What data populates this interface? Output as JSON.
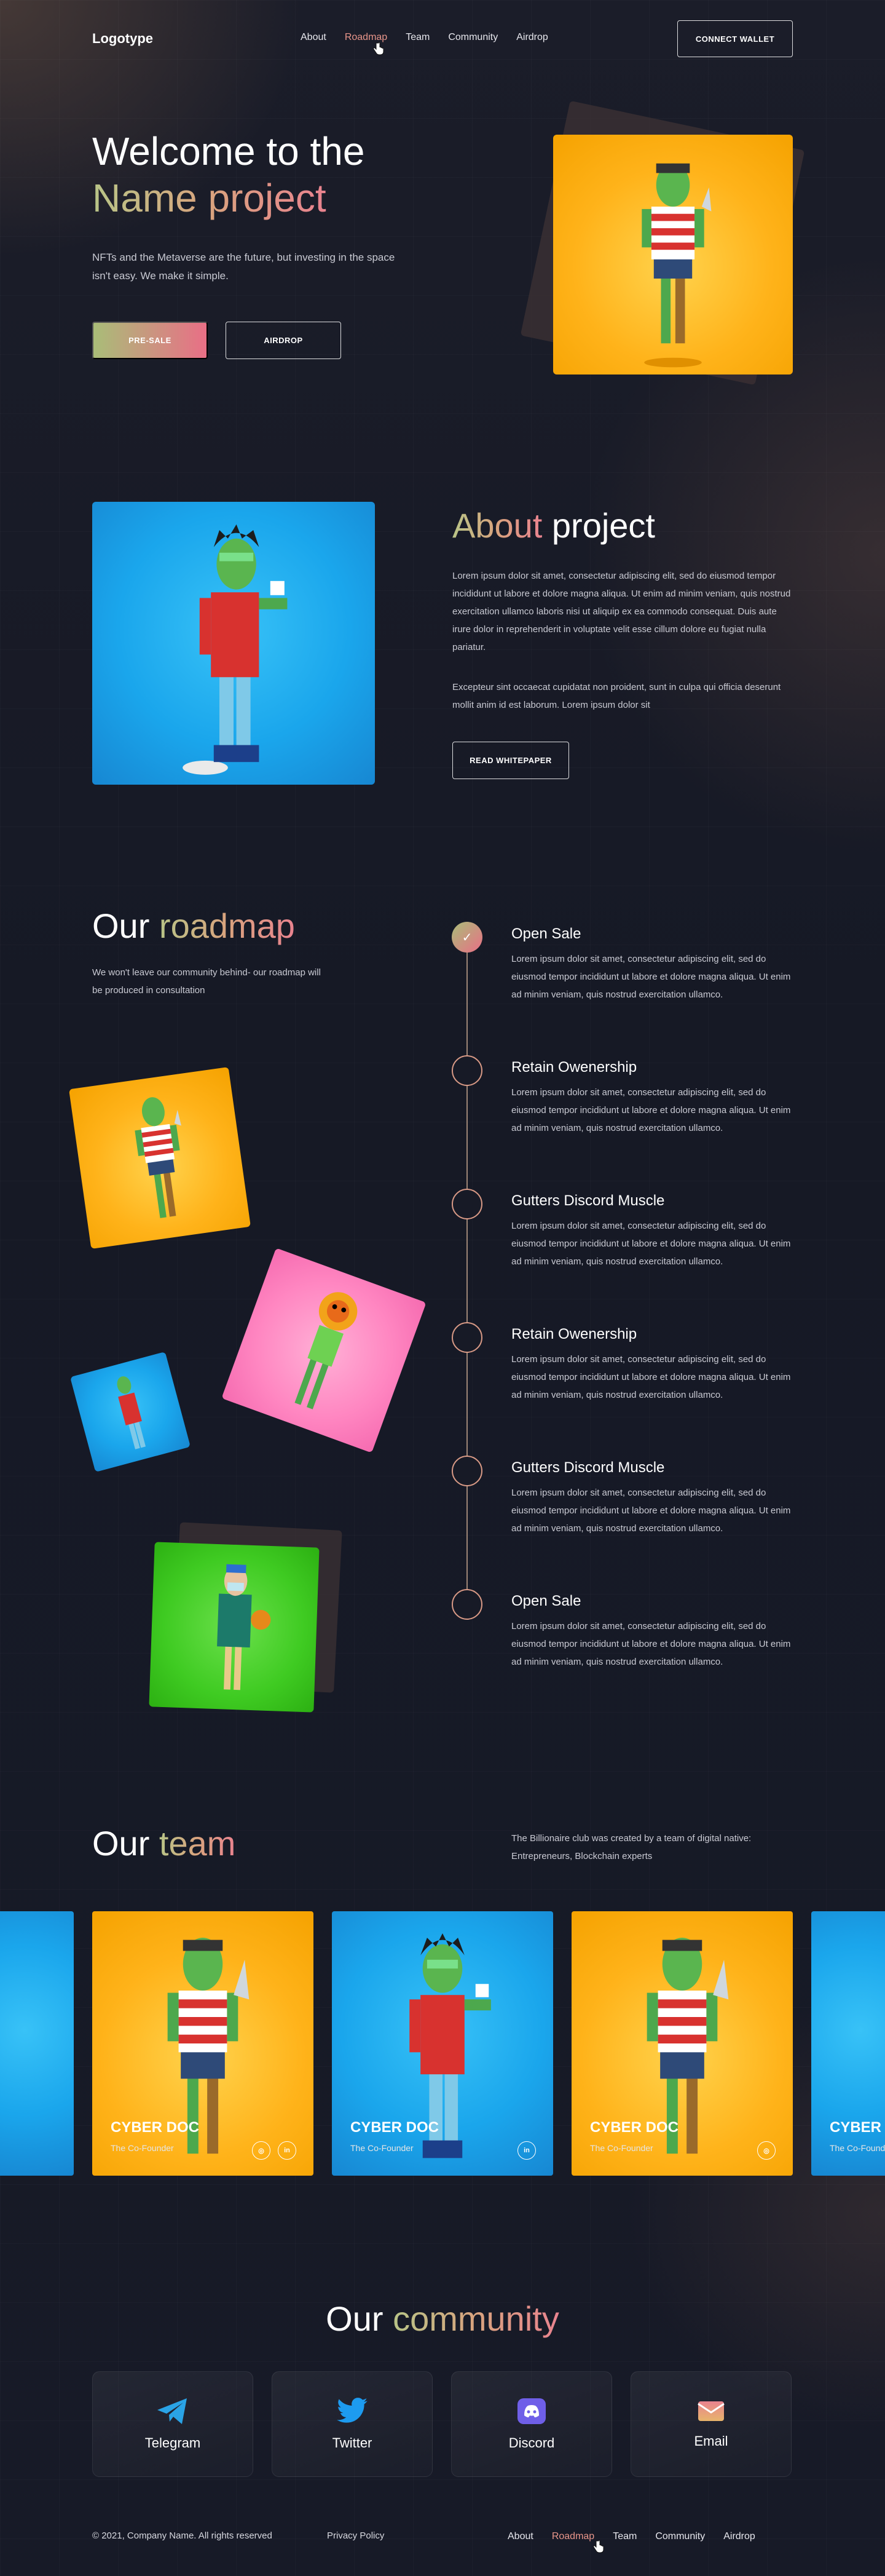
{
  "header": {
    "logo": "Logotype",
    "nav": [
      "About",
      "Roadmap",
      "Team",
      "Community",
      "Airdrop"
    ],
    "active_nav": "Roadmap",
    "connect_wallet": "CONNECT WALLET"
  },
  "hero": {
    "title_line1": "Welcome to the",
    "title_line2": "Name project",
    "subtitle": "NFTs and the Metaverse are the future, but investing in the space isn't easy. We make it simple.",
    "presale": "PRE-SALE",
    "airdrop": "AIRDROP"
  },
  "about": {
    "title_accent": "About",
    "title_rest": "project",
    "para1": "Lorem ipsum dolor sit amet, consectetur adipiscing elit, sed do eiusmod tempor incididunt ut labore et dolore magna aliqua. Ut enim ad minim veniam, quis nostrud exercitation ullamco laboris nisi ut aliquip ex ea commodo consequat. Duis aute irure dolor in reprehenderit in voluptate velit esse cillum dolore eu fugiat nulla pariatur.",
    "para2": "Excepteur sint occaecat cupidatat non proident, sunt in culpa qui officia deserunt mollit anim id est laborum. Lorem ipsum dolor sit",
    "whitepaper": "READ WHITEPAPER"
  },
  "roadmap": {
    "title_plain": "Our",
    "title_accent": "roadmap",
    "subtitle": "We won't leave our community behind- our roadmap will be produced in consultation",
    "items": [
      {
        "title": "Open Sale",
        "text": "Lorem ipsum dolor sit amet, consectetur adipiscing elit, sed do eiusmod tempor incididunt ut labore et dolore magna aliqua. Ut enim ad minim veniam, quis nostrud exercitation ullamco.",
        "done": true
      },
      {
        "title": "Retain Owenership",
        "text": "Lorem ipsum dolor sit amet, consectetur adipiscing elit, sed do eiusmod tempor incididunt ut labore et dolore magna aliqua. Ut enim ad minim veniam, quis nostrud exercitation ullamco.",
        "done": false
      },
      {
        "title": "Gutters Discord Muscle",
        "text": "Lorem ipsum dolor sit amet, consectetur adipiscing elit, sed do eiusmod tempor incididunt ut labore et dolore magna aliqua. Ut enim ad minim veniam, quis nostrud exercitation ullamco.",
        "done": false
      },
      {
        "title": "Retain Owenership",
        "text": "Lorem ipsum dolor sit amet, consectetur adipiscing elit, sed do eiusmod tempor incididunt ut labore et dolore magna aliqua. Ut enim ad minim veniam, quis nostrud exercitation ullamco.",
        "done": false
      },
      {
        "title": "Gutters Discord Muscle",
        "text": "Lorem ipsum dolor sit amet, consectetur adipiscing elit, sed do eiusmod tempor incididunt ut labore et dolore magna aliqua. Ut enim ad minim veniam, quis nostrud exercitation ullamco.",
        "done": false
      },
      {
        "title": "Open Sale",
        "text": "Lorem ipsum dolor sit amet, consectetur adipiscing elit, sed do eiusmod tempor incididunt ut labore et dolore magna aliqua. Ut enim ad minim veniam, quis nostrud exercitation ullamco.",
        "done": false
      }
    ]
  },
  "team": {
    "title_plain": "Our",
    "title_accent": "team",
    "subtitle": "The Billionaire club was created by a team of digital native: Entrepreneurs, Blockchain experts",
    "members": [
      {
        "name": "CYBER DOC",
        "role": "The Co-Founder",
        "socials": [
          "instagram",
          "linkedin"
        ]
      },
      {
        "name": "CYBER DOC",
        "role": "The Co-Founder",
        "socials": [
          "linkedin"
        ]
      },
      {
        "name": "CYBER DOC",
        "role": "The Co-Founder",
        "socials": [
          "instagram"
        ]
      },
      {
        "name": "CYBER DOC",
        "role": "The Co-Founder",
        "socials": []
      }
    ],
    "social_glyphs": {
      "instagram": "◎",
      "linkedin": "in"
    }
  },
  "community": {
    "title_plain": "Our",
    "title_accent": "community",
    "items": [
      {
        "label": "Telegram",
        "icon": "telegram-icon",
        "color": "#2aa3e6"
      },
      {
        "label": "Twitter",
        "icon": "twitter-icon",
        "color": "#1d9bf0"
      },
      {
        "label": "Discord",
        "icon": "discord-icon",
        "color": "#6f5fe8"
      },
      {
        "label": "Email",
        "icon": "email-icon",
        "color": "#e79a6b"
      }
    ]
  },
  "footer": {
    "copyright": "© 2021, Company Name. All rights reserved",
    "privacy": "Privacy Policy",
    "nav": [
      "About",
      "Roadmap",
      "Team",
      "Community",
      "Airdrop"
    ],
    "active_nav": "Roadmap"
  },
  "colors": {
    "accent_start": "#b8c487",
    "accent_mid": "#d9a37e",
    "accent_end": "#e9838f",
    "background": "#171a26"
  }
}
